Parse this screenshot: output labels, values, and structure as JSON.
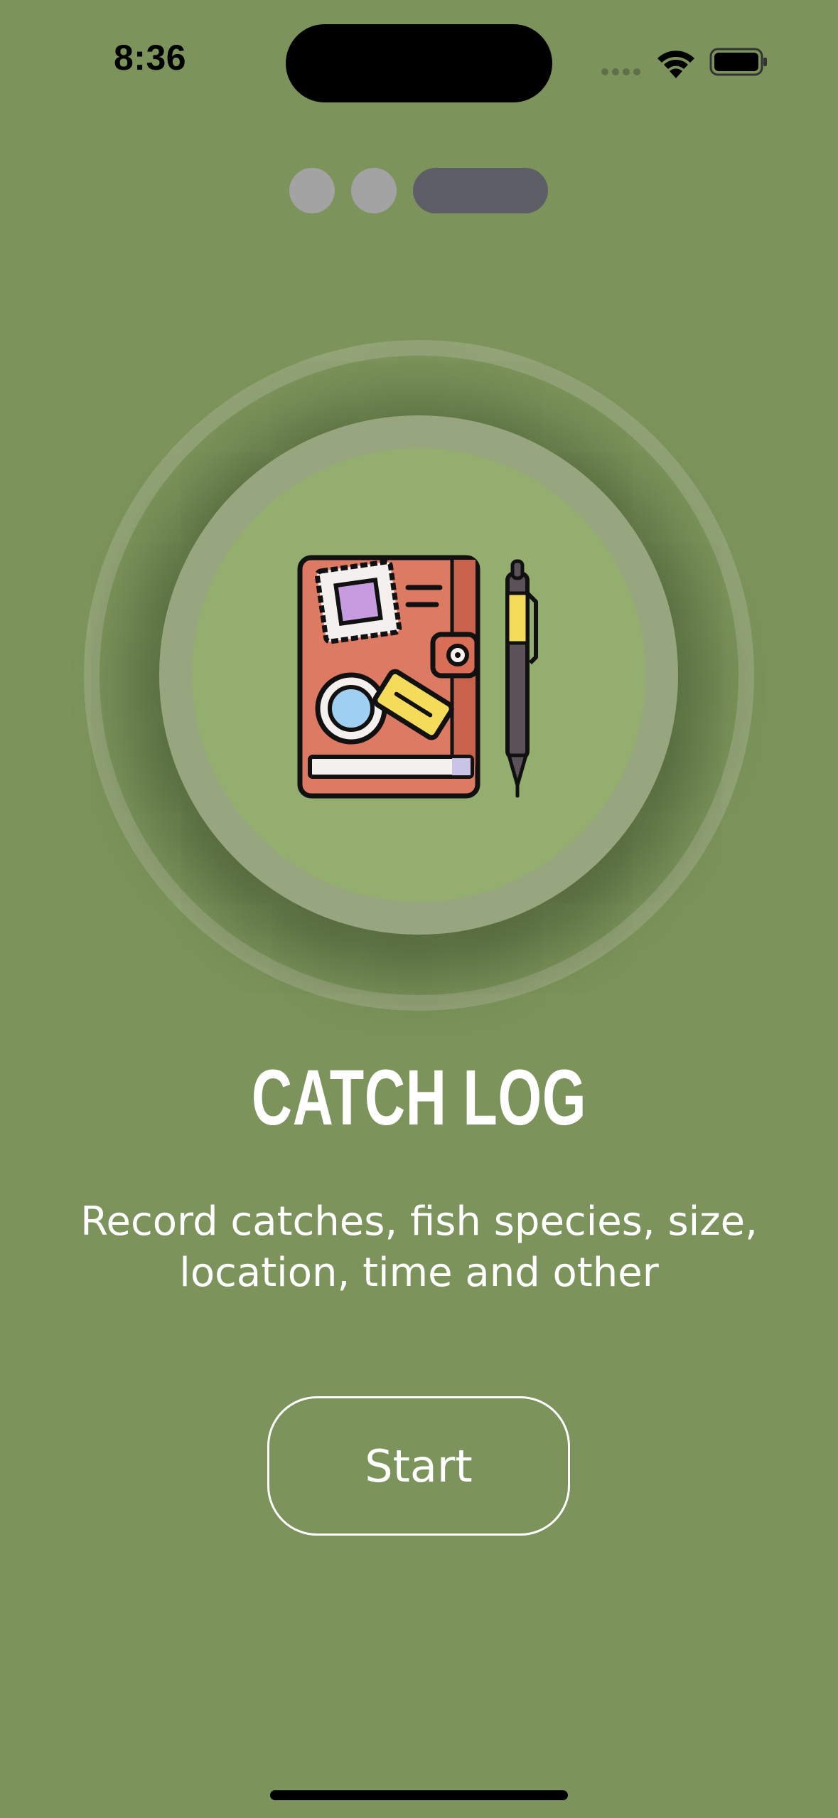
{
  "status_bar": {
    "time": "8:36",
    "icons": [
      "cellular-signal-icon",
      "wifi-icon",
      "battery-icon"
    ]
  },
  "page_indicator": {
    "total": 3,
    "active_index": 2
  },
  "hero": {
    "icon": "journal-with-pen-icon"
  },
  "title": "CATCH LOG",
  "description_lines": [
    "Record catches, fish species, size,",
    "location, time and other"
  ],
  "start_button_label": "Start",
  "colors": {
    "background": "#7c945b",
    "dot_inactive": "#a3a3a4",
    "dot_active": "#5e5e66",
    "circle_inner": "#93ae6e",
    "circle_ring": "#98a67f",
    "text": "#ffffff"
  }
}
